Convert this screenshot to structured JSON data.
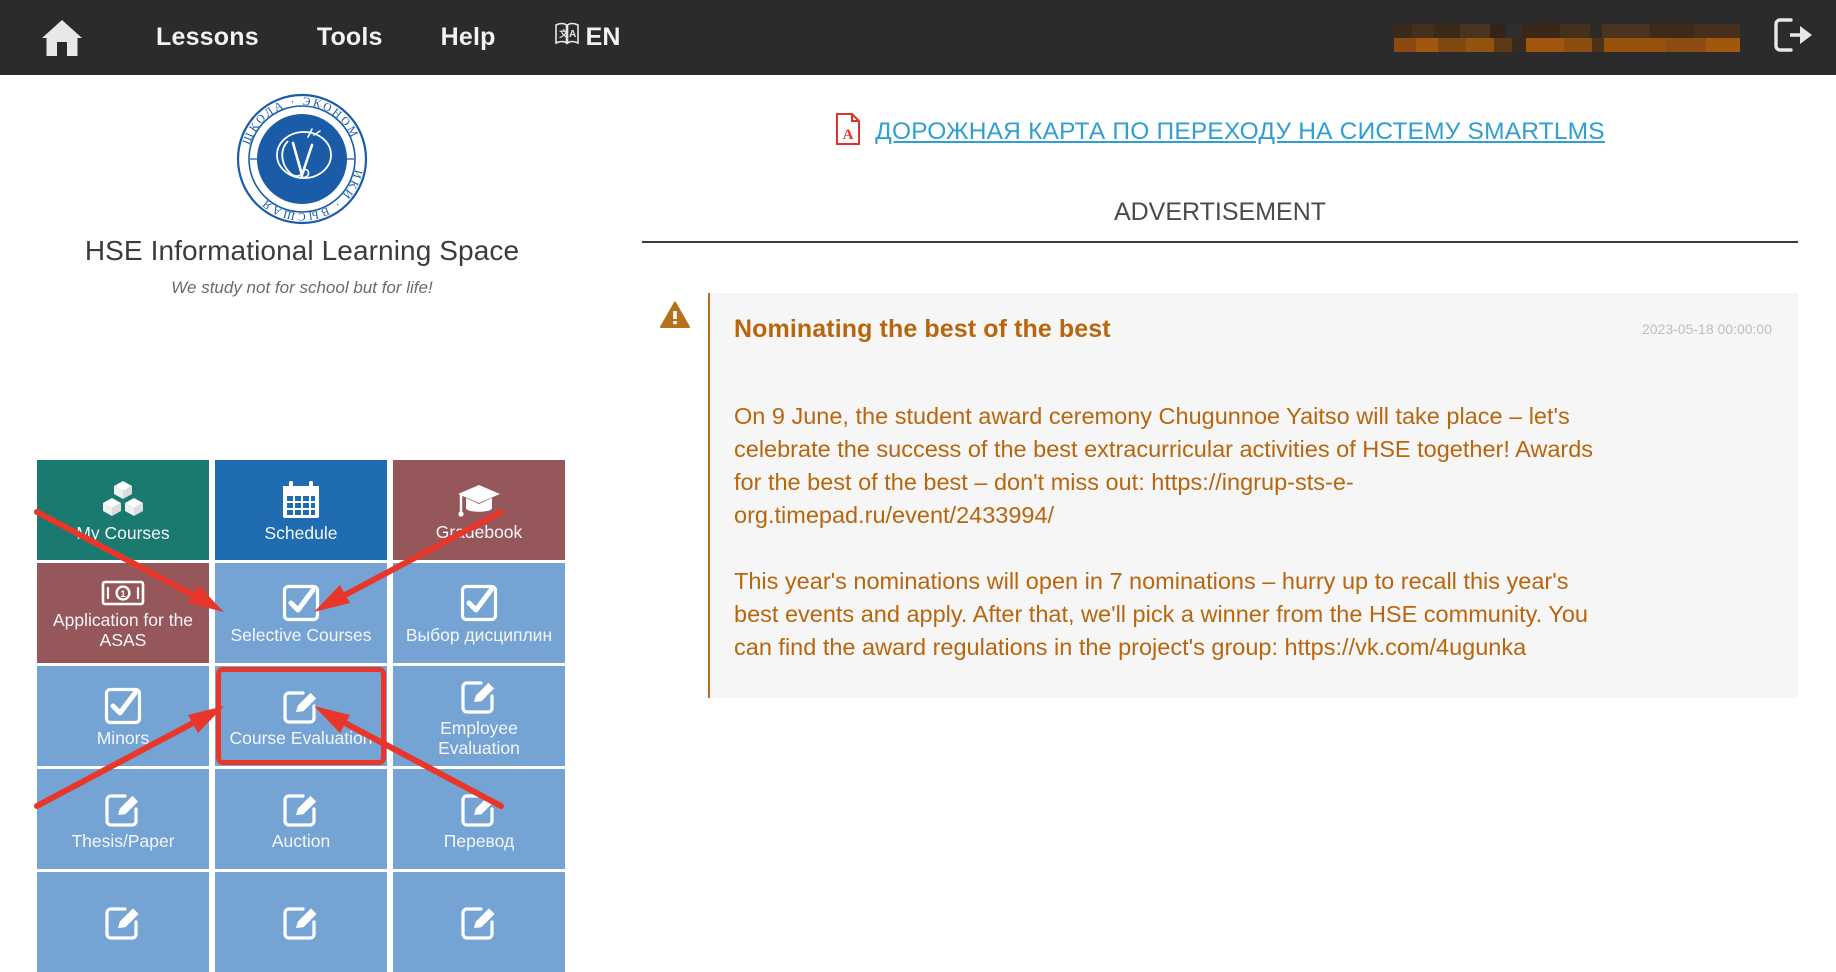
{
  "nav": {
    "home_icon": "home-icon",
    "items": [
      {
        "label": "Lessons"
      },
      {
        "label": "Tools"
      },
      {
        "label": "Help"
      }
    ],
    "language": {
      "label": "EN",
      "icon": "translate-icon"
    },
    "user_name_redacted": "",
    "logout_icon": "logout-icon"
  },
  "brand": {
    "logo_alt": "hse-logo",
    "logo_ring_text": "ВЫСШАЯ ШКОЛА ЭКОНОМИКИ",
    "title": "HSE Informational Learning Space",
    "tagline": "We study not for school but for life!"
  },
  "tiles": [
    {
      "label": "My Courses",
      "icon": "blocks-icon",
      "color_class": "t-teal",
      "color": "#1b7a70",
      "highlighted": false
    },
    {
      "label": "Schedule",
      "icon": "calendar-icon",
      "color_class": "t-blue",
      "color": "#1f6cb0",
      "highlighted": false
    },
    {
      "label": "Gradebook",
      "icon": "graduation-cap-icon",
      "color_class": "t-rose",
      "color": "#95575a",
      "highlighted": false
    },
    {
      "label": "Application for the ASAS",
      "icon": "banknote-icon",
      "color_class": "t-rose",
      "color": "#95575a",
      "highlighted": false
    },
    {
      "label": "Selective Courses",
      "icon": "checkbox-icon",
      "color_class": "t-light",
      "color": "#74a3d4",
      "highlighted": false
    },
    {
      "label": "Выбор дисциплин",
      "icon": "checkbox-icon",
      "color_class": "t-light",
      "color": "#74a3d4",
      "highlighted": false
    },
    {
      "label": "Minors",
      "icon": "checkbox-icon",
      "color_class": "t-light",
      "color": "#74a3d4",
      "highlighted": false
    },
    {
      "label": "Course Evaluation",
      "icon": "edit-square-icon",
      "color_class": "t-light",
      "color": "#74a3d4",
      "highlighted": true
    },
    {
      "label": "Employee Evaluation",
      "icon": "edit-square-icon",
      "color_class": "t-light",
      "color": "#74a3d4",
      "highlighted": false
    },
    {
      "label": "Thesis/Paper",
      "icon": "edit-square-icon",
      "color_class": "t-light",
      "color": "#74a3d4",
      "highlighted": false
    },
    {
      "label": "Auction",
      "icon": "edit-square-icon",
      "color_class": "t-light",
      "color": "#74a3d4",
      "highlighted": false
    },
    {
      "label": "Перевод",
      "icon": "edit-square-icon",
      "color_class": "t-light",
      "color": "#74a3d4",
      "highlighted": false
    },
    {
      "label": "",
      "icon": "edit-square-icon",
      "color_class": "t-light",
      "color": "#74a3d4",
      "highlighted": false
    },
    {
      "label": "",
      "icon": "edit-square-icon",
      "color_class": "t-light",
      "color": "#74a3d4",
      "highlighted": false
    },
    {
      "label": "",
      "icon": "edit-square-icon",
      "color_class": "t-light",
      "color": "#74a3d4",
      "highlighted": false
    }
  ],
  "annotations": {
    "highlight_color": "#e8372a",
    "target_tile": "Course Evaluation",
    "arrow_count": 4
  },
  "main": {
    "pdf_link": {
      "text": "ДОРОЖНАЯ КАРТА ПО ПЕРЕХОДУ НА СИСТЕМУ SMARTLMS",
      "icon": "pdf-file-icon",
      "color": "#2f9fd0"
    },
    "section_title": "ADVERTISEMENT",
    "announcement": {
      "icon": "warning-triangle-icon",
      "title": "Nominating the best of the best",
      "timestamp": "2023-05-18 00:00:00",
      "accent_color": "#b8660e",
      "paragraphs": [
        "On 9 June, the student award ceremony Chugunnoe Yaitso will take place – let's celebrate the success of the best extracurricular activities of HSE together! Awards for the best of the best – don't miss out: https://ingrup-sts-e-org.timepad.ru/event/2433994/",
        "This year's nominations will open in 7 nominations – hurry up to recall this year's best events and apply. After that, we'll pick a winner from the HSE community. You can find the award regulations in the project's group: https://vk.com/4ugunka"
      ]
    }
  }
}
